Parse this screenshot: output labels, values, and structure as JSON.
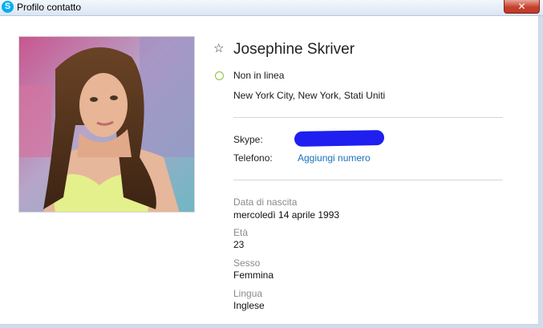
{
  "window": {
    "title": "Profilo contatto",
    "app_icon": "skype-icon",
    "app_icon_glyph": "S",
    "close_glyph": "✕"
  },
  "profile": {
    "favorite_icon": "star-outline-icon",
    "favorite_glyph": "☆",
    "name": "Josephine Skriver",
    "status_icon": "offline-status-icon",
    "status": "Non in linea",
    "location": "New York City, New York, Stati Uniti"
  },
  "contact_info": {
    "skype_label": "Skype:",
    "phone_label": "Telefono:",
    "add_number_link": "Aggiungi numero"
  },
  "details": {
    "birthdate_label": "Data di nascita",
    "birthdate": "mercoledì 14 aprile 1993",
    "age_label": "Età",
    "age": "23",
    "gender_label": "Sesso",
    "gender": "Femmina",
    "language_label": "Lingua",
    "language": "Inglese"
  },
  "colors": {
    "link": "#1a72b8",
    "status_offline": "#8cbf3a",
    "redaction": "#1f1ff0",
    "close_button": "#c8412c"
  }
}
